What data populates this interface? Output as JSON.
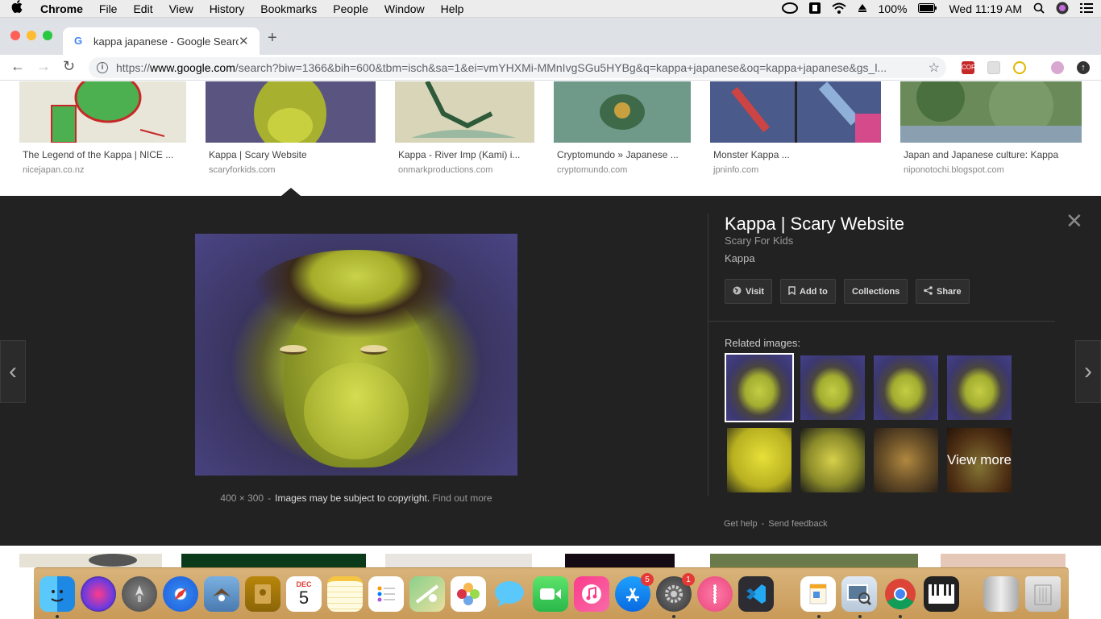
{
  "menubar": {
    "apple": "",
    "app_name": "Chrome",
    "menus": [
      "File",
      "Edit",
      "View",
      "History",
      "Bookmarks",
      "People",
      "Window",
      "Help"
    ],
    "battery": "100%",
    "clock": "Wed 11:19 AM"
  },
  "tab": {
    "favicon": "G",
    "title": "kappa japanese - Google Search",
    "close": "✕",
    "new_tab": "+"
  },
  "toolbar": {
    "back": "←",
    "forward": "→",
    "reload": "↻",
    "url_scheme": "https://",
    "url_host": "www.google.com",
    "url_rest": "/search?biw=1366&bih=600&tbm=isch&sa=1&ei=vmYHXMi-MMnIvgSGu5HYBg&q=kappa+japanese&oq=kappa+japanese&gs_l...",
    "star": "☆"
  },
  "results": [
    {
      "caption": "The Legend of the Kappa | NICE ...",
      "source": "nicejapan.co.nz",
      "color": "#e8e6d8"
    },
    {
      "caption": "Kappa | Scary Website",
      "source": "scaryforkids.com",
      "color": "#5a5580"
    },
    {
      "caption": "Kappa - River Imp (Kami) i...",
      "source": "onmarkproductions.com",
      "color": "#d8d5b8"
    },
    {
      "caption": "Cryptomundo » Japanese ...",
      "source": "cryptomundo.com",
      "color": "#6f9a8a"
    },
    {
      "caption": "Monster Kappa ...",
      "source": "jpninfo.com",
      "color": "#4a5a8a"
    },
    {
      "caption": "Japan and Japanese culture: Kappa",
      "source": "niponotochi.blogspot.com",
      "color": "#6a8a5a"
    }
  ],
  "panel": {
    "title": "Kappa | Scary Website",
    "site": "Scary For Kids",
    "description": "Kappa",
    "buttons": {
      "visit": "Visit",
      "add_to": "Add to",
      "collections": "Collections",
      "share": "Share"
    },
    "dimensions": "400 × 300",
    "separator": "-",
    "copyright": "Images may be subject to copyright.",
    "find_out_more": "Find out more",
    "related_label": "Related images:",
    "view_more": "View more",
    "get_help": "Get help",
    "send_feedback": "Send feedback",
    "close": "✕",
    "prev": "‹",
    "next": "›"
  },
  "dock": {
    "calendar_month": "DEC",
    "calendar_day": "5",
    "appstore_badge": "5",
    "prefs_badge": "1"
  }
}
